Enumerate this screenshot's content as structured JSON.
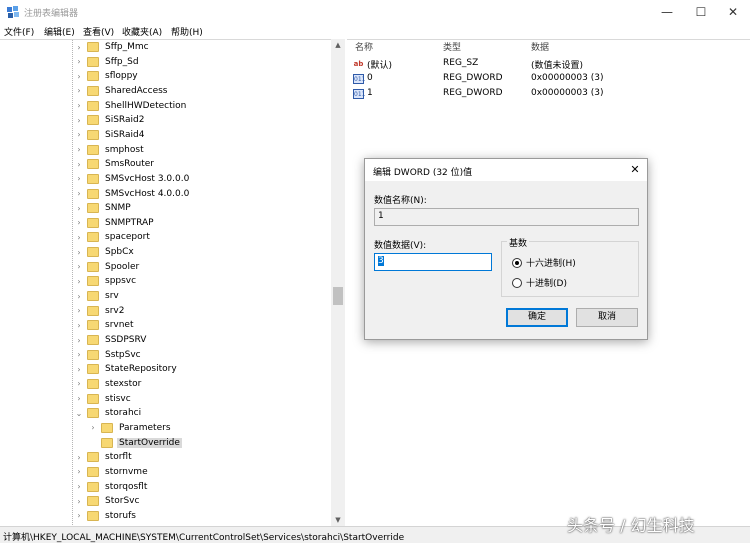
{
  "window": {
    "title": "注册表编辑器",
    "controls": {
      "minimize": "—",
      "maximize": "☐",
      "close": "✕"
    }
  },
  "menu": [
    "文件(F)",
    "编辑(E)",
    "查看(V)",
    "收藏夹(A)",
    "帮助(H)"
  ],
  "tree": {
    "items": [
      {
        "label": "Sffp_Mmc",
        "expanded": false
      },
      {
        "label": "Sffp_Sd",
        "expanded": false
      },
      {
        "label": "sfloppy",
        "expanded": false
      },
      {
        "label": "SharedAccess",
        "expanded": false
      },
      {
        "label": "ShellHWDetection",
        "expanded": false
      },
      {
        "label": "SiSRaid2",
        "expanded": false
      },
      {
        "label": "SiSRaid4",
        "expanded": false
      },
      {
        "label": "smphost",
        "expanded": false
      },
      {
        "label": "SmsRouter",
        "expanded": false
      },
      {
        "label": "SMSvcHost 3.0.0.0",
        "expanded": false
      },
      {
        "label": "SMSvcHost 4.0.0.0",
        "expanded": false
      },
      {
        "label": "SNMP",
        "expanded": false
      },
      {
        "label": "SNMPTRAP",
        "expanded": false
      },
      {
        "label": "spaceport",
        "expanded": false
      },
      {
        "label": "SpbCx",
        "expanded": false
      },
      {
        "label": "Spooler",
        "expanded": false
      },
      {
        "label": "sppsvc",
        "expanded": false
      },
      {
        "label": "srv",
        "expanded": false
      },
      {
        "label": "srv2",
        "expanded": false
      },
      {
        "label": "srvnet",
        "expanded": false
      },
      {
        "label": "SSDPSRV",
        "expanded": false
      },
      {
        "label": "SstpSvc",
        "expanded": false
      },
      {
        "label": "StateRepository",
        "expanded": false
      },
      {
        "label": "stexstor",
        "expanded": false
      },
      {
        "label": "stisvc",
        "expanded": false
      },
      {
        "label": "storahci",
        "expanded": true
      },
      {
        "label": "Parameters",
        "expanded": false,
        "child": true
      },
      {
        "label": "StartOverride",
        "child": true,
        "selected": true,
        "leaf": true
      },
      {
        "label": "storflt",
        "expanded": false
      },
      {
        "label": "stornvme",
        "expanded": false
      },
      {
        "label": "storqosflt",
        "expanded": false
      },
      {
        "label": "StorSvc",
        "expanded": false
      },
      {
        "label": "storufs",
        "expanded": false
      }
    ]
  },
  "list": {
    "headers": {
      "name": "名称",
      "type": "类型",
      "data": "数据"
    },
    "rows": [
      {
        "icon": "ab",
        "name": "(默认)",
        "type": "REG_SZ",
        "data": "(数值未设置)"
      },
      {
        "icon": "011",
        "name": "0",
        "type": "REG_DWORD",
        "data": "0x00000003 (3)"
      },
      {
        "icon": "011",
        "name": "1",
        "type": "REG_DWORD",
        "data": "0x00000003 (3)"
      }
    ]
  },
  "dialog": {
    "title": "编辑 DWORD (32 位)值",
    "close": "✕",
    "name_label": "数值名称(N):",
    "name_value": "1",
    "data_label": "数值数据(V):",
    "data_value": "3",
    "base_title": "基数",
    "radio_hex": "十六进制(H)",
    "radio_dec": "十进制(D)",
    "selected_base": "hex",
    "ok": "确定",
    "cancel": "取消"
  },
  "status": {
    "path": "计算机\\HKEY_LOCAL_MACHINE\\SYSTEM\\CurrentControlSet\\Services\\storahci\\StartOverride"
  },
  "watermark": "头条号 / 幻生科技"
}
